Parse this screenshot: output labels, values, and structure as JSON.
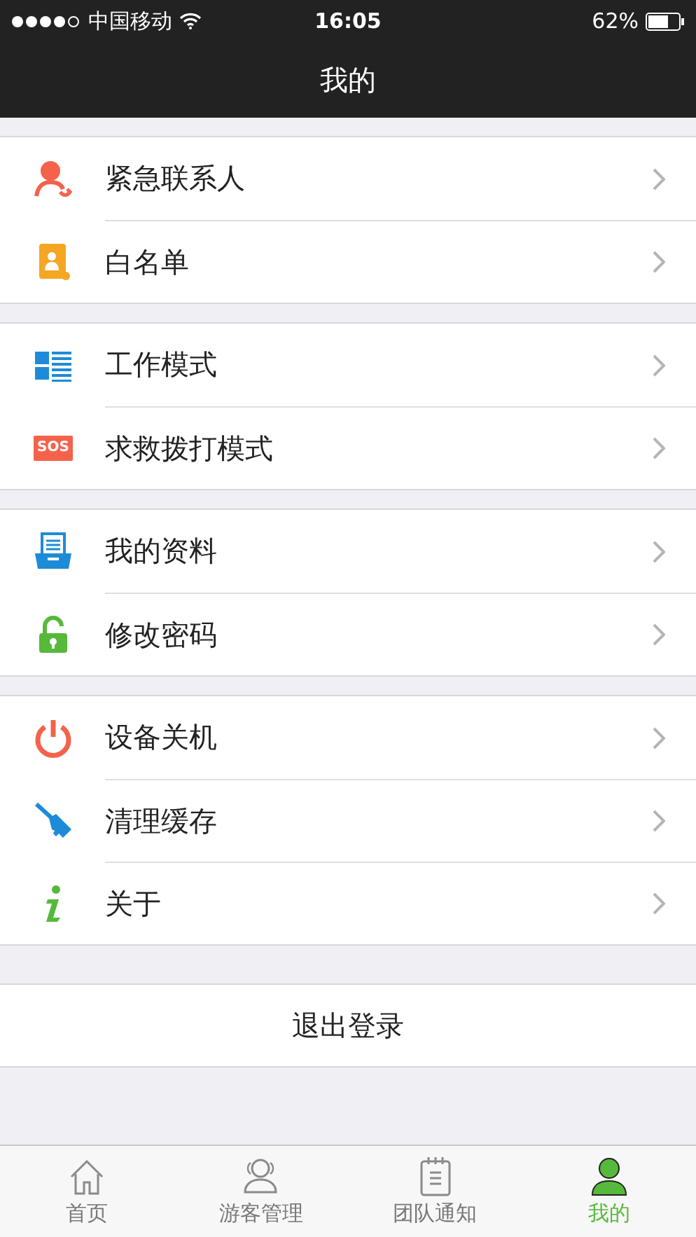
{
  "status_bar": {
    "carrier": "中国移动",
    "time": "16:05",
    "battery": "62%"
  },
  "nav": {
    "title": "我的"
  },
  "sections": [
    {
      "items": [
        {
          "kind": "contact",
          "label": "紧急联系人"
        },
        {
          "kind": "whitelist",
          "label": "白名单"
        }
      ]
    },
    {
      "items": [
        {
          "kind": "workmode",
          "label": "工作模式"
        },
        {
          "kind": "sos",
          "label": "求救拨打模式",
          "icon_text": "SOS"
        }
      ]
    },
    {
      "items": [
        {
          "kind": "profile",
          "label": "我的资料"
        },
        {
          "kind": "password",
          "label": "修改密码"
        }
      ]
    },
    {
      "items": [
        {
          "kind": "power",
          "label": "设备关机"
        },
        {
          "kind": "clean",
          "label": "清理缓存"
        },
        {
          "kind": "about",
          "label": "关于"
        }
      ]
    }
  ],
  "logout": "退出登录",
  "tabs": [
    {
      "kind": "home",
      "label": "首页",
      "selected": false
    },
    {
      "kind": "visitors",
      "label": "游客管理",
      "selected": false
    },
    {
      "kind": "notice",
      "label": "团队通知",
      "selected": false
    },
    {
      "kind": "me",
      "label": "我的",
      "selected": true
    }
  ]
}
